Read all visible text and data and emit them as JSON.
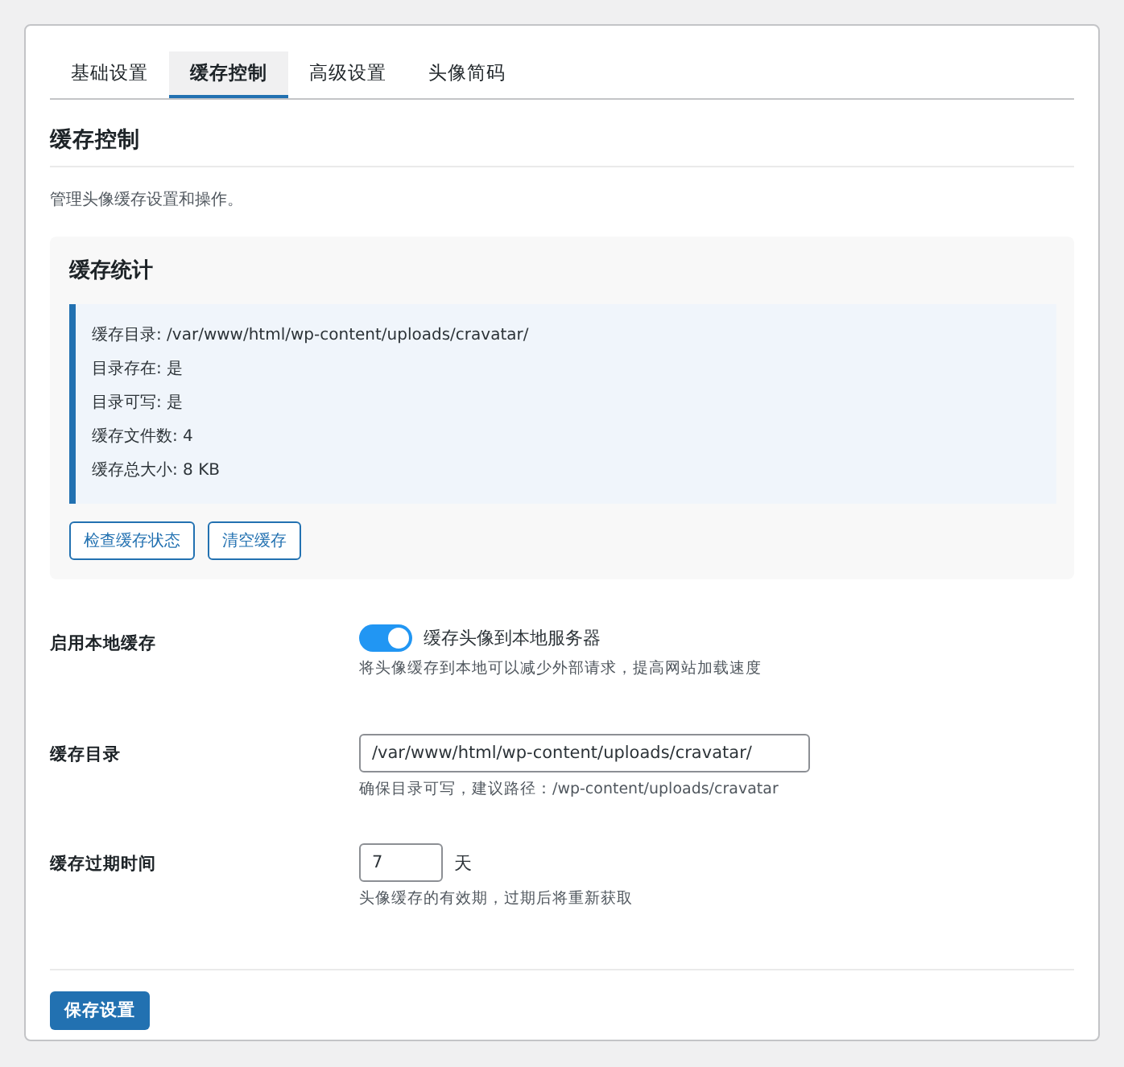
{
  "tabs": [
    {
      "label": "基础设置",
      "selected": false
    },
    {
      "label": "缓存控制",
      "selected": true
    },
    {
      "label": "高级设置",
      "selected": false
    },
    {
      "label": "头像简码",
      "selected": false
    }
  ],
  "section": {
    "title": "缓存控制",
    "description": "管理头像缓存设置和操作。"
  },
  "stats": {
    "title": "缓存统计",
    "lines": [
      "缓存目录: /var/www/html/wp-content/uploads/cravatar/",
      "目录存在: 是",
      "目录可写: 是",
      "缓存文件数: 4",
      "缓存总大小: 8 KB"
    ],
    "buttons": [
      "检查缓存状态",
      "清空缓存"
    ]
  },
  "settings": [
    {
      "kind": "toggle",
      "label": "启用本地缓存",
      "on": true,
      "toggle_label": "缓存头像到本地服务器",
      "hint": "将头像缓存到本地可以减少外部请求，提高网站加载速度"
    },
    {
      "kind": "text",
      "label": "缓存目录",
      "value": "/var/www/html/wp-content/uploads/cravatar/",
      "hint": "确保目录可写，建议路径：/wp-content/uploads/cravatar"
    },
    {
      "kind": "number",
      "label": "缓存过期时间",
      "value": "7",
      "unit": "天",
      "hint": "头像缓存的有效期，过期后将重新获取"
    }
  ],
  "save_button": "保存设置"
}
